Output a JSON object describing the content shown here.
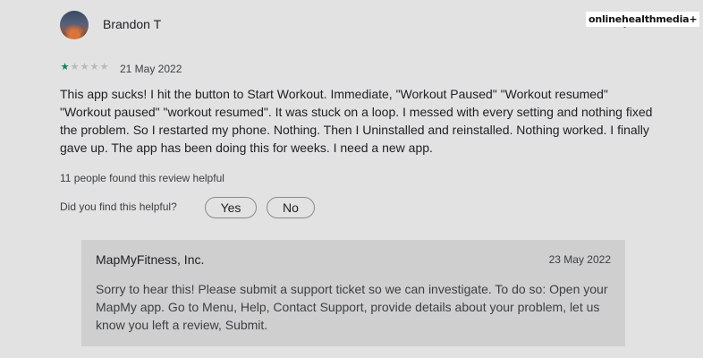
{
  "review": {
    "author": "Brandon T",
    "rating": 1,
    "max_rating": 5,
    "date": "21 May 2022",
    "text": "This app sucks! I hit the button to Start Workout. Immediate, \"Workout Paused\" \"Workout resumed\" \"Workout paused\" \"workout resumed\". It was stuck on a loop. I messed with every setting and nothing fixed the problem. So I restarted my phone. Nothing. Then I Uninstalled and reinstalled. Nothing worked. I finally gave up. The app has been doing this for weeks. I need a new app.",
    "helpful_count_text": "11 people found this review helpful",
    "helpful_question": "Did you find this helpful?",
    "yes_label": "Yes",
    "no_label": "No"
  },
  "reply": {
    "developer": "MapMyFitness, Inc.",
    "date": "23 May 2022",
    "text": "Sorry to hear this! Please submit a support ticket so we can investigate. To do so: Open your MapMy app. Go to Menu, Help, Contact Support, provide details about your problem, let us know you left a review, Submit."
  },
  "watermark": "onlinehealthmedia+",
  "colors": {
    "star_filled": "#01875f",
    "star_empty": "#b9b9b9",
    "reply_background": "#cfcfcf",
    "page_background": "#e2e2e2"
  },
  "icons": {
    "more_menu": "more-vert-icon",
    "star": "star-icon"
  }
}
